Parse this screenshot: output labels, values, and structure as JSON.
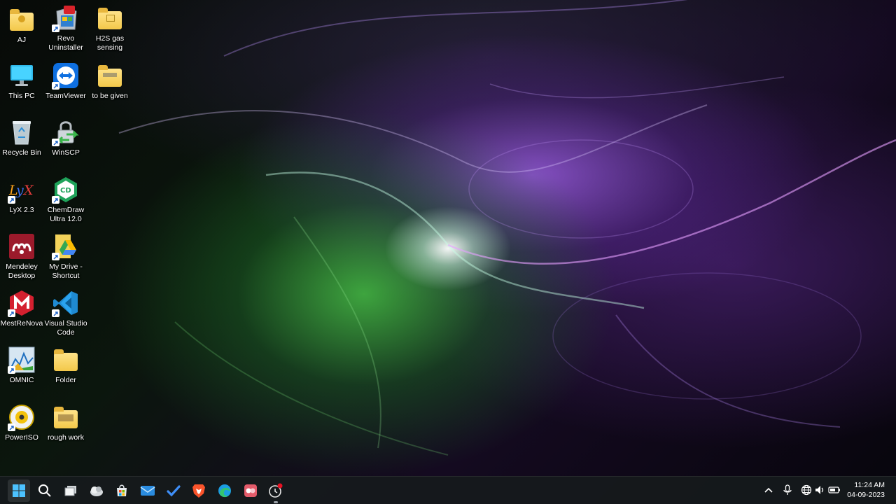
{
  "desktop": {
    "icons": [
      {
        "label": "AJ",
        "icon": "user-folder-icon",
        "shortcut": false
      },
      {
        "label": "Revo\nUninstaller",
        "icon": "revo-uninstaller-icon",
        "shortcut": true
      },
      {
        "label": "H2S gas\nsensing",
        "icon": "folder-icon",
        "shortcut": false
      },
      {
        "label": "This PC",
        "icon": "monitor-icon",
        "shortcut": false
      },
      {
        "label": "TeamViewer",
        "icon": "teamviewer-icon",
        "shortcut": true
      },
      {
        "label": "to be given",
        "icon": "folder-icon",
        "shortcut": false
      },
      {
        "label": "Recycle Bin",
        "icon": "recycle-bin-icon",
        "shortcut": false
      },
      {
        "label": "WinSCP",
        "icon": "winscp-icon",
        "shortcut": true
      },
      {
        "label": "LyX 2.3",
        "icon": "lyx-icon",
        "shortcut": true
      },
      {
        "label": "ChemDraw\nUltra 12.0",
        "icon": "chemdraw-icon",
        "shortcut": true
      },
      {
        "label": "Mendeley\nDesktop",
        "icon": "mendeley-icon",
        "shortcut": false
      },
      {
        "label": "My Drive -\nShortcut",
        "icon": "google-drive-icon",
        "shortcut": true
      },
      {
        "label": "MestReNova",
        "icon": "mestrenova-icon",
        "shortcut": true
      },
      {
        "label": "Visual Studio\nCode",
        "icon": "vscode-icon",
        "shortcut": true
      },
      {
        "label": "OMNIC",
        "icon": "omnic-icon",
        "shortcut": true
      },
      {
        "label": "Folder",
        "icon": "folder-icon",
        "shortcut": false
      },
      {
        "label": "PowerISO",
        "icon": "poweriso-icon",
        "shortcut": true
      },
      {
        "label": "rough work",
        "icon": "folder-icon",
        "shortcut": false
      }
    ]
  },
  "taskbar": {
    "apps": [
      {
        "icon": "windows-start-icon",
        "active": true
      },
      {
        "icon": "search-icon",
        "active": false
      },
      {
        "icon": "task-view-icon",
        "active": false
      },
      {
        "icon": "widgets-icon",
        "active": false
      },
      {
        "icon": "microsoft-store-icon",
        "active": false
      },
      {
        "icon": "mail-icon",
        "active": false
      },
      {
        "icon": "todo-check-icon",
        "active": false
      },
      {
        "icon": "brave-browser-icon",
        "active": false
      },
      {
        "icon": "edge-browser-icon",
        "active": false
      },
      {
        "icon": "app-icon",
        "active": false
      },
      {
        "icon": "recorder-icon",
        "active": false
      }
    ],
    "tray": [
      "chevron-up-icon",
      "microphone-icon",
      "network-globe-icon",
      "volume-icon",
      "battery-icon"
    ],
    "clock": {
      "time": "11:24 AM",
      "date": "04-09-2023"
    }
  },
  "colors": {
    "taskbar_bg": "#16191b",
    "folder_yellow": "#f3c84a",
    "accent_blue": "#4cc2ff"
  }
}
